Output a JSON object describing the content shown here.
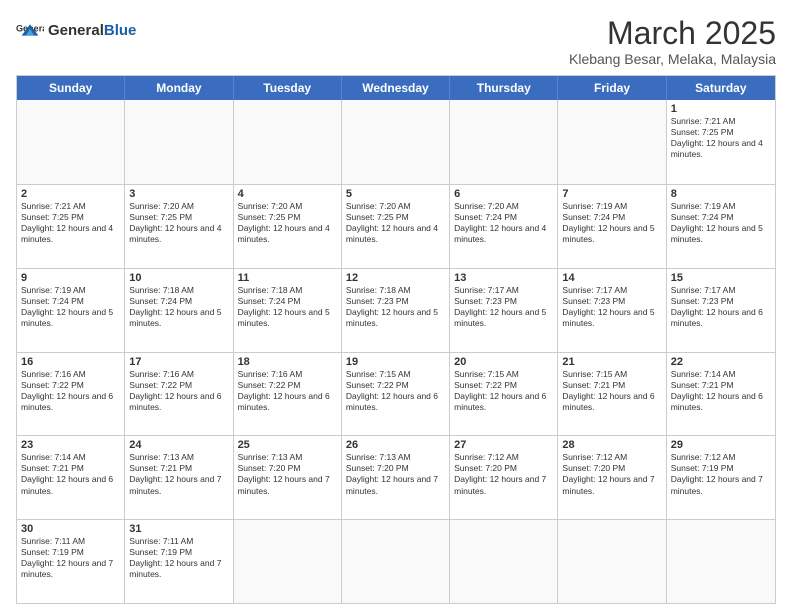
{
  "header": {
    "logo_general": "General",
    "logo_blue": "Blue",
    "title": "March 2025",
    "subtitle": "Klebang Besar, Melaka, Malaysia"
  },
  "weekdays": [
    "Sunday",
    "Monday",
    "Tuesday",
    "Wednesday",
    "Thursday",
    "Friday",
    "Saturday"
  ],
  "weeks": [
    [
      {
        "day": "",
        "info": ""
      },
      {
        "day": "",
        "info": ""
      },
      {
        "day": "",
        "info": ""
      },
      {
        "day": "",
        "info": ""
      },
      {
        "day": "",
        "info": ""
      },
      {
        "day": "",
        "info": ""
      },
      {
        "day": "1",
        "info": "Sunrise: 7:21 AM\nSunset: 7:25 PM\nDaylight: 12 hours and 4 minutes."
      }
    ],
    [
      {
        "day": "2",
        "info": "Sunrise: 7:21 AM\nSunset: 7:25 PM\nDaylight: 12 hours and 4 minutes."
      },
      {
        "day": "3",
        "info": "Sunrise: 7:20 AM\nSunset: 7:25 PM\nDaylight: 12 hours and 4 minutes."
      },
      {
        "day": "4",
        "info": "Sunrise: 7:20 AM\nSunset: 7:25 PM\nDaylight: 12 hours and 4 minutes."
      },
      {
        "day": "5",
        "info": "Sunrise: 7:20 AM\nSunset: 7:25 PM\nDaylight: 12 hours and 4 minutes."
      },
      {
        "day": "6",
        "info": "Sunrise: 7:20 AM\nSunset: 7:24 PM\nDaylight: 12 hours and 4 minutes."
      },
      {
        "day": "7",
        "info": "Sunrise: 7:19 AM\nSunset: 7:24 PM\nDaylight: 12 hours and 5 minutes."
      },
      {
        "day": "8",
        "info": "Sunrise: 7:19 AM\nSunset: 7:24 PM\nDaylight: 12 hours and 5 minutes."
      }
    ],
    [
      {
        "day": "9",
        "info": "Sunrise: 7:19 AM\nSunset: 7:24 PM\nDaylight: 12 hours and 5 minutes."
      },
      {
        "day": "10",
        "info": "Sunrise: 7:18 AM\nSunset: 7:24 PM\nDaylight: 12 hours and 5 minutes."
      },
      {
        "day": "11",
        "info": "Sunrise: 7:18 AM\nSunset: 7:24 PM\nDaylight: 12 hours and 5 minutes."
      },
      {
        "day": "12",
        "info": "Sunrise: 7:18 AM\nSunset: 7:23 PM\nDaylight: 12 hours and 5 minutes."
      },
      {
        "day": "13",
        "info": "Sunrise: 7:17 AM\nSunset: 7:23 PM\nDaylight: 12 hours and 5 minutes."
      },
      {
        "day": "14",
        "info": "Sunrise: 7:17 AM\nSunset: 7:23 PM\nDaylight: 12 hours and 5 minutes."
      },
      {
        "day": "15",
        "info": "Sunrise: 7:17 AM\nSunset: 7:23 PM\nDaylight: 12 hours and 6 minutes."
      }
    ],
    [
      {
        "day": "16",
        "info": "Sunrise: 7:16 AM\nSunset: 7:22 PM\nDaylight: 12 hours and 6 minutes."
      },
      {
        "day": "17",
        "info": "Sunrise: 7:16 AM\nSunset: 7:22 PM\nDaylight: 12 hours and 6 minutes."
      },
      {
        "day": "18",
        "info": "Sunrise: 7:16 AM\nSunset: 7:22 PM\nDaylight: 12 hours and 6 minutes."
      },
      {
        "day": "19",
        "info": "Sunrise: 7:15 AM\nSunset: 7:22 PM\nDaylight: 12 hours and 6 minutes."
      },
      {
        "day": "20",
        "info": "Sunrise: 7:15 AM\nSunset: 7:22 PM\nDaylight: 12 hours and 6 minutes."
      },
      {
        "day": "21",
        "info": "Sunrise: 7:15 AM\nSunset: 7:21 PM\nDaylight: 12 hours and 6 minutes."
      },
      {
        "day": "22",
        "info": "Sunrise: 7:14 AM\nSunset: 7:21 PM\nDaylight: 12 hours and 6 minutes."
      }
    ],
    [
      {
        "day": "23",
        "info": "Sunrise: 7:14 AM\nSunset: 7:21 PM\nDaylight: 12 hours and 6 minutes."
      },
      {
        "day": "24",
        "info": "Sunrise: 7:13 AM\nSunset: 7:21 PM\nDaylight: 12 hours and 7 minutes."
      },
      {
        "day": "25",
        "info": "Sunrise: 7:13 AM\nSunset: 7:20 PM\nDaylight: 12 hours and 7 minutes."
      },
      {
        "day": "26",
        "info": "Sunrise: 7:13 AM\nSunset: 7:20 PM\nDaylight: 12 hours and 7 minutes."
      },
      {
        "day": "27",
        "info": "Sunrise: 7:12 AM\nSunset: 7:20 PM\nDaylight: 12 hours and 7 minutes."
      },
      {
        "day": "28",
        "info": "Sunrise: 7:12 AM\nSunset: 7:20 PM\nDaylight: 12 hours and 7 minutes."
      },
      {
        "day": "29",
        "info": "Sunrise: 7:12 AM\nSunset: 7:19 PM\nDaylight: 12 hours and 7 minutes."
      }
    ],
    [
      {
        "day": "30",
        "info": "Sunrise: 7:11 AM\nSunset: 7:19 PM\nDaylight: 12 hours and 7 minutes."
      },
      {
        "day": "31",
        "info": "Sunrise: 7:11 AM\nSunset: 7:19 PM\nDaylight: 12 hours and 7 minutes."
      },
      {
        "day": "",
        "info": ""
      },
      {
        "day": "",
        "info": ""
      },
      {
        "day": "",
        "info": ""
      },
      {
        "day": "",
        "info": ""
      },
      {
        "day": "",
        "info": ""
      }
    ]
  ]
}
